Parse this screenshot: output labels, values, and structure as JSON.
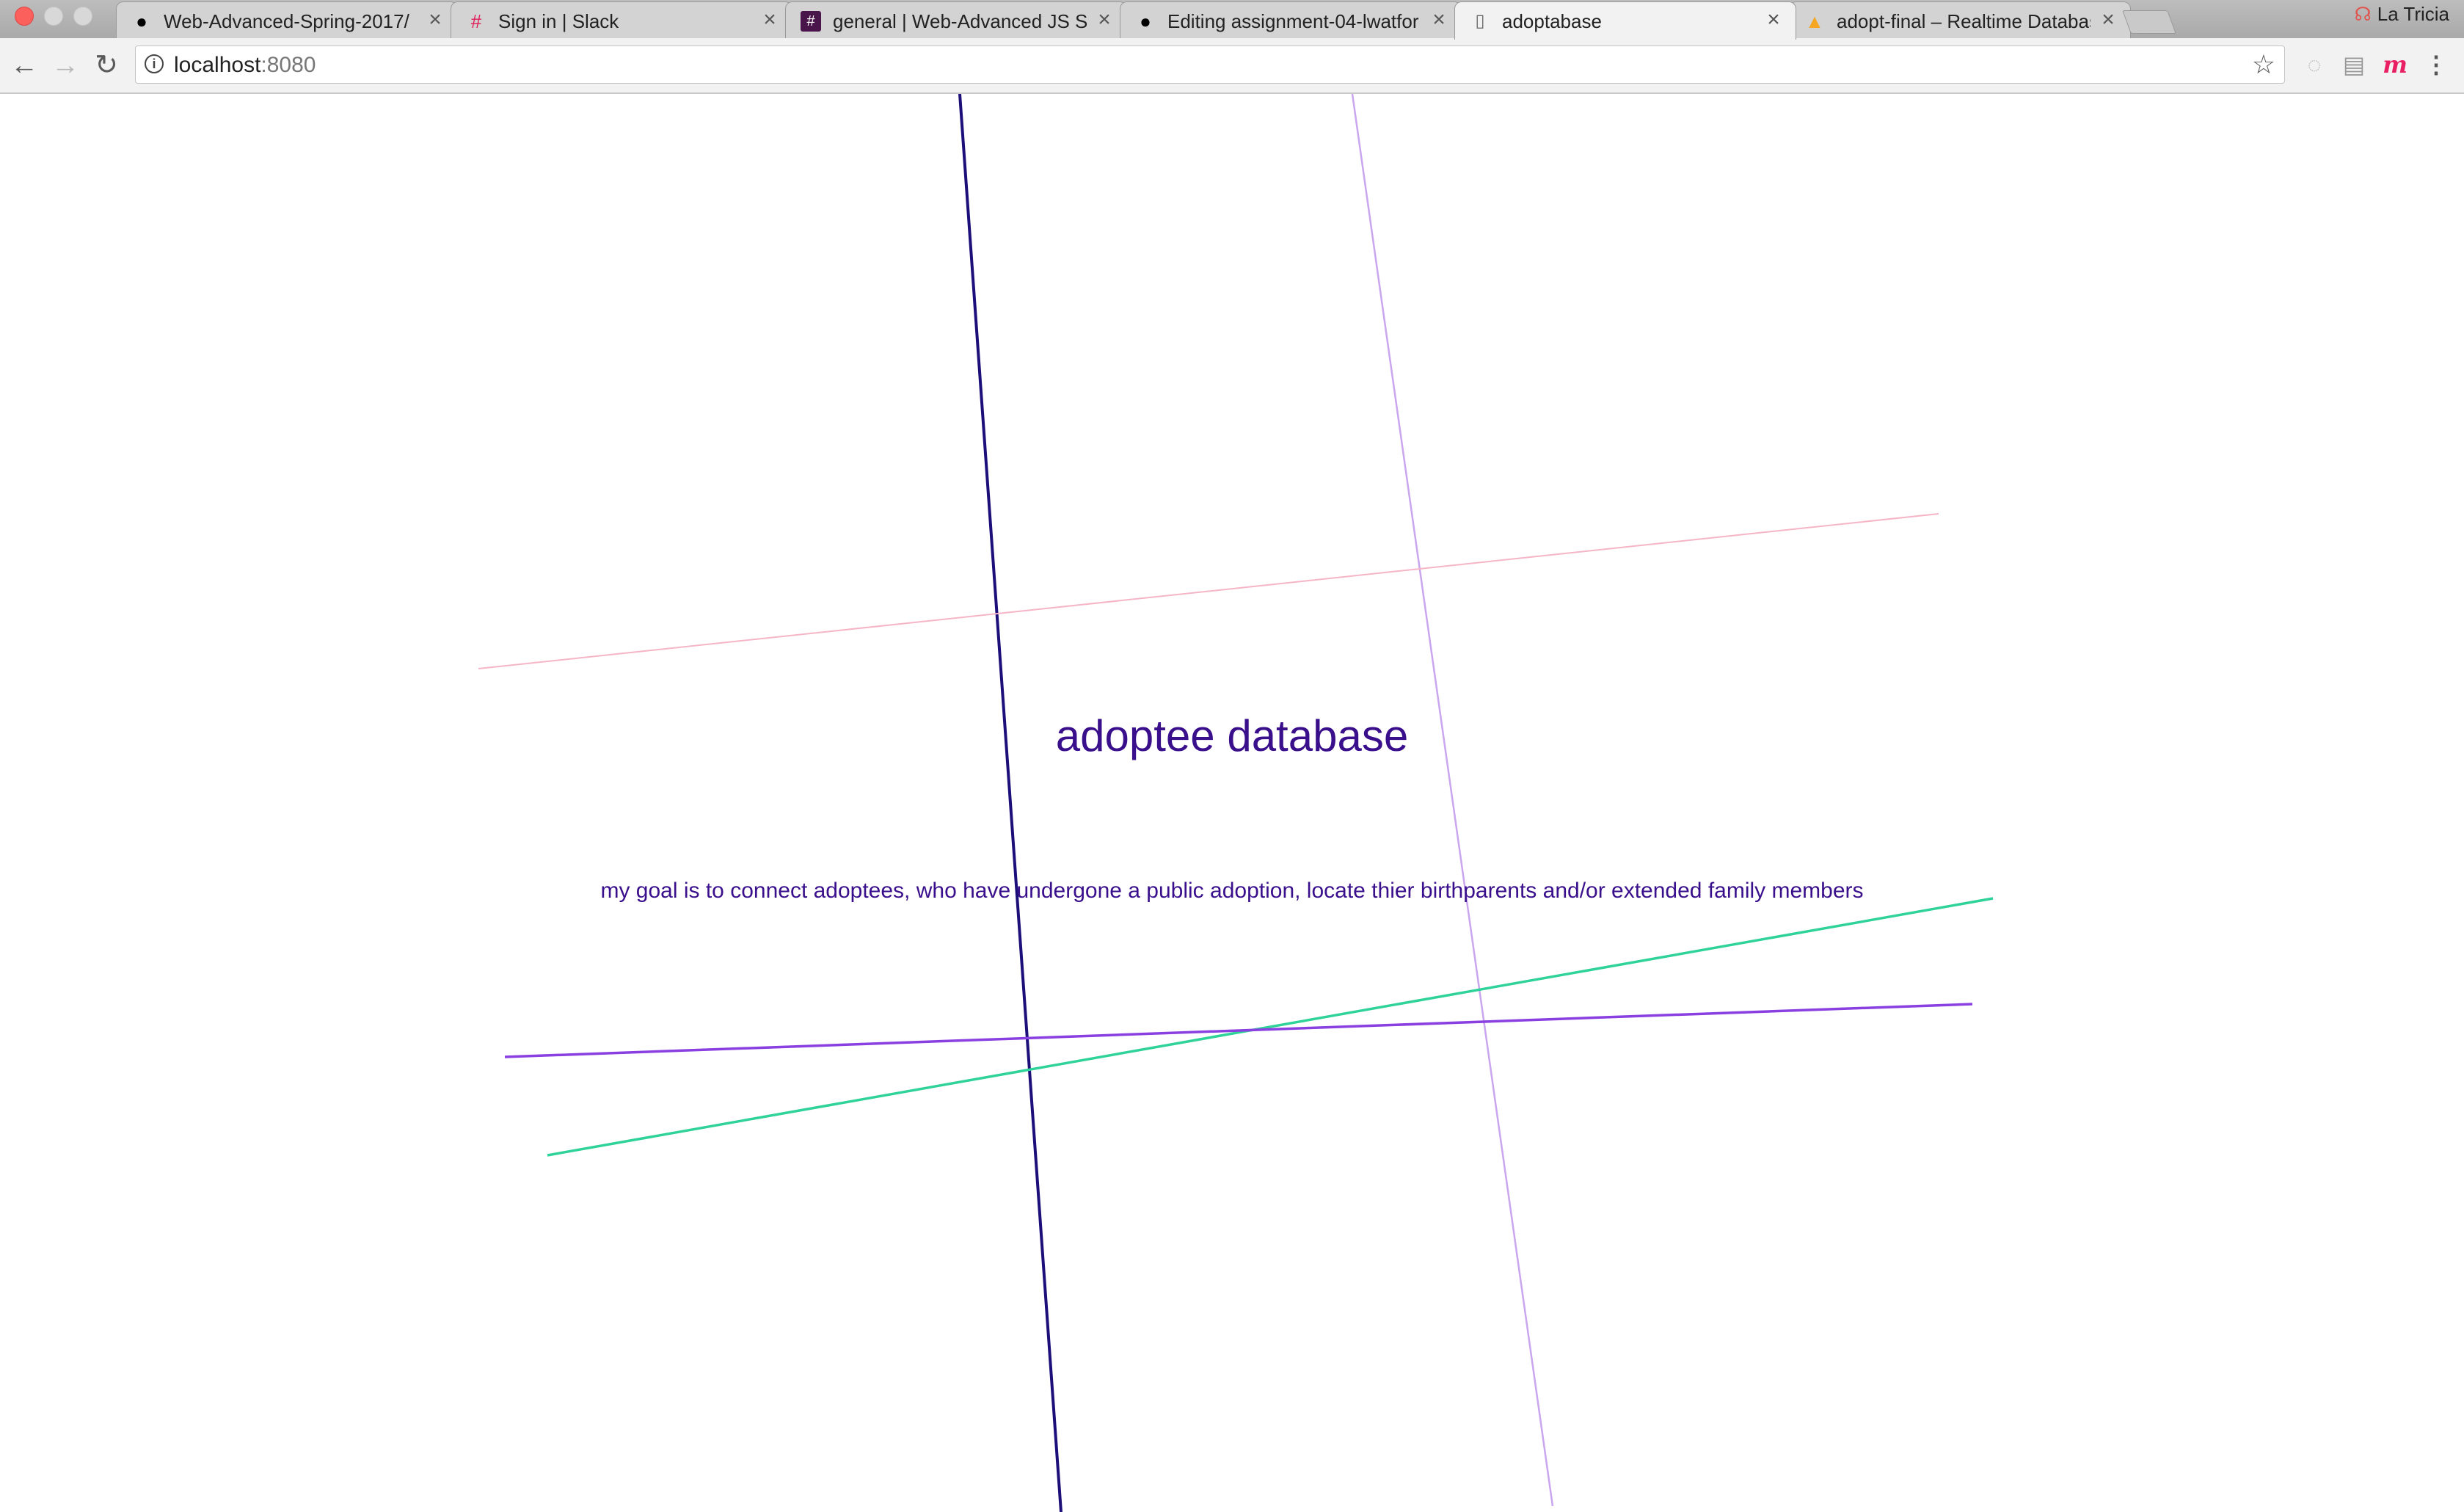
{
  "browser": {
    "tabs": [
      {
        "label": "Web-Advanced-Spring-2017/",
        "icon": "github-icon",
        "active": false
      },
      {
        "label": "Sign in | Slack",
        "icon": "slack-icon",
        "active": false
      },
      {
        "label": "general | Web-Advanced JS Sl",
        "icon": "hash-icon",
        "active": false
      },
      {
        "label": "Editing assignment-04-lwatfor",
        "icon": "github-icon",
        "active": false
      },
      {
        "label": "adoptabase",
        "icon": "page-icon",
        "active": true
      },
      {
        "label": "adopt-final – Realtime Databas",
        "icon": "firebase-icon",
        "active": false
      }
    ],
    "profile_name": "La Tricia",
    "url_host": "localhost",
    "url_port": ":8080"
  },
  "page": {
    "title": "adoptee database",
    "description": "my goal is to connect adoptees, who have undergone a public adoption, locate thier birthparents and/or extended family members",
    "text_color": "#3a0f8c",
    "line_colors": [
      "#1c0f7a",
      "#c9a6ee",
      "#f5b5c7",
      "#2fd39a",
      "#8a3fe0"
    ]
  }
}
